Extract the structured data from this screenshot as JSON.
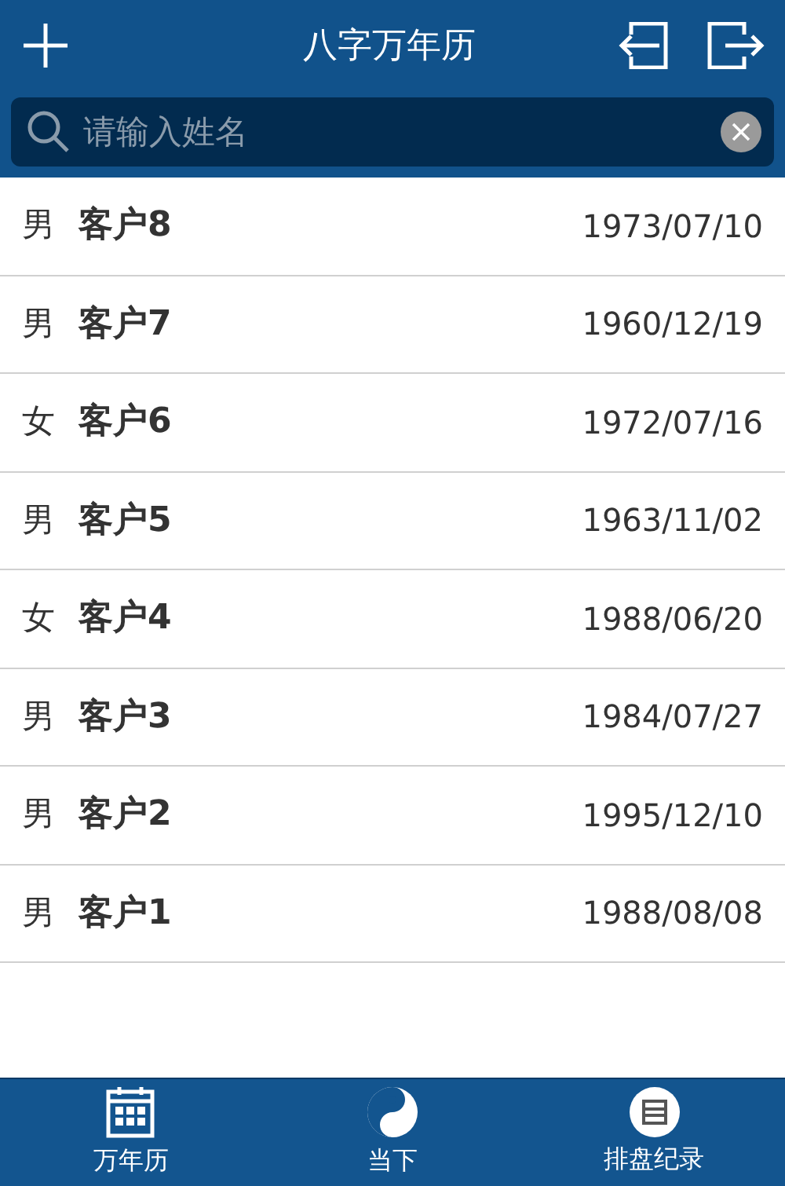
{
  "header": {
    "title": "八字万年历"
  },
  "search": {
    "placeholder": "请输入姓名"
  },
  "customers": [
    {
      "gender": "男",
      "name": "客户8",
      "date": "1973/07/10"
    },
    {
      "gender": "男",
      "name": "客户7",
      "date": "1960/12/19"
    },
    {
      "gender": "女",
      "name": "客户6",
      "date": "1972/07/16"
    },
    {
      "gender": "男",
      "name": "客户5",
      "date": "1963/11/02"
    },
    {
      "gender": "女",
      "name": "客户4",
      "date": "1988/06/20"
    },
    {
      "gender": "男",
      "name": "客户3",
      "date": "1984/07/27"
    },
    {
      "gender": "男",
      "name": "客户2",
      "date": "1995/12/10"
    },
    {
      "gender": "男",
      "name": "客户1",
      "date": "1988/08/08"
    }
  ],
  "tabs": [
    {
      "kind": "calendar",
      "label": "万年历"
    },
    {
      "kind": "yinyang",
      "label": "当下"
    },
    {
      "kind": "records",
      "label": "排盘纪录"
    }
  ]
}
